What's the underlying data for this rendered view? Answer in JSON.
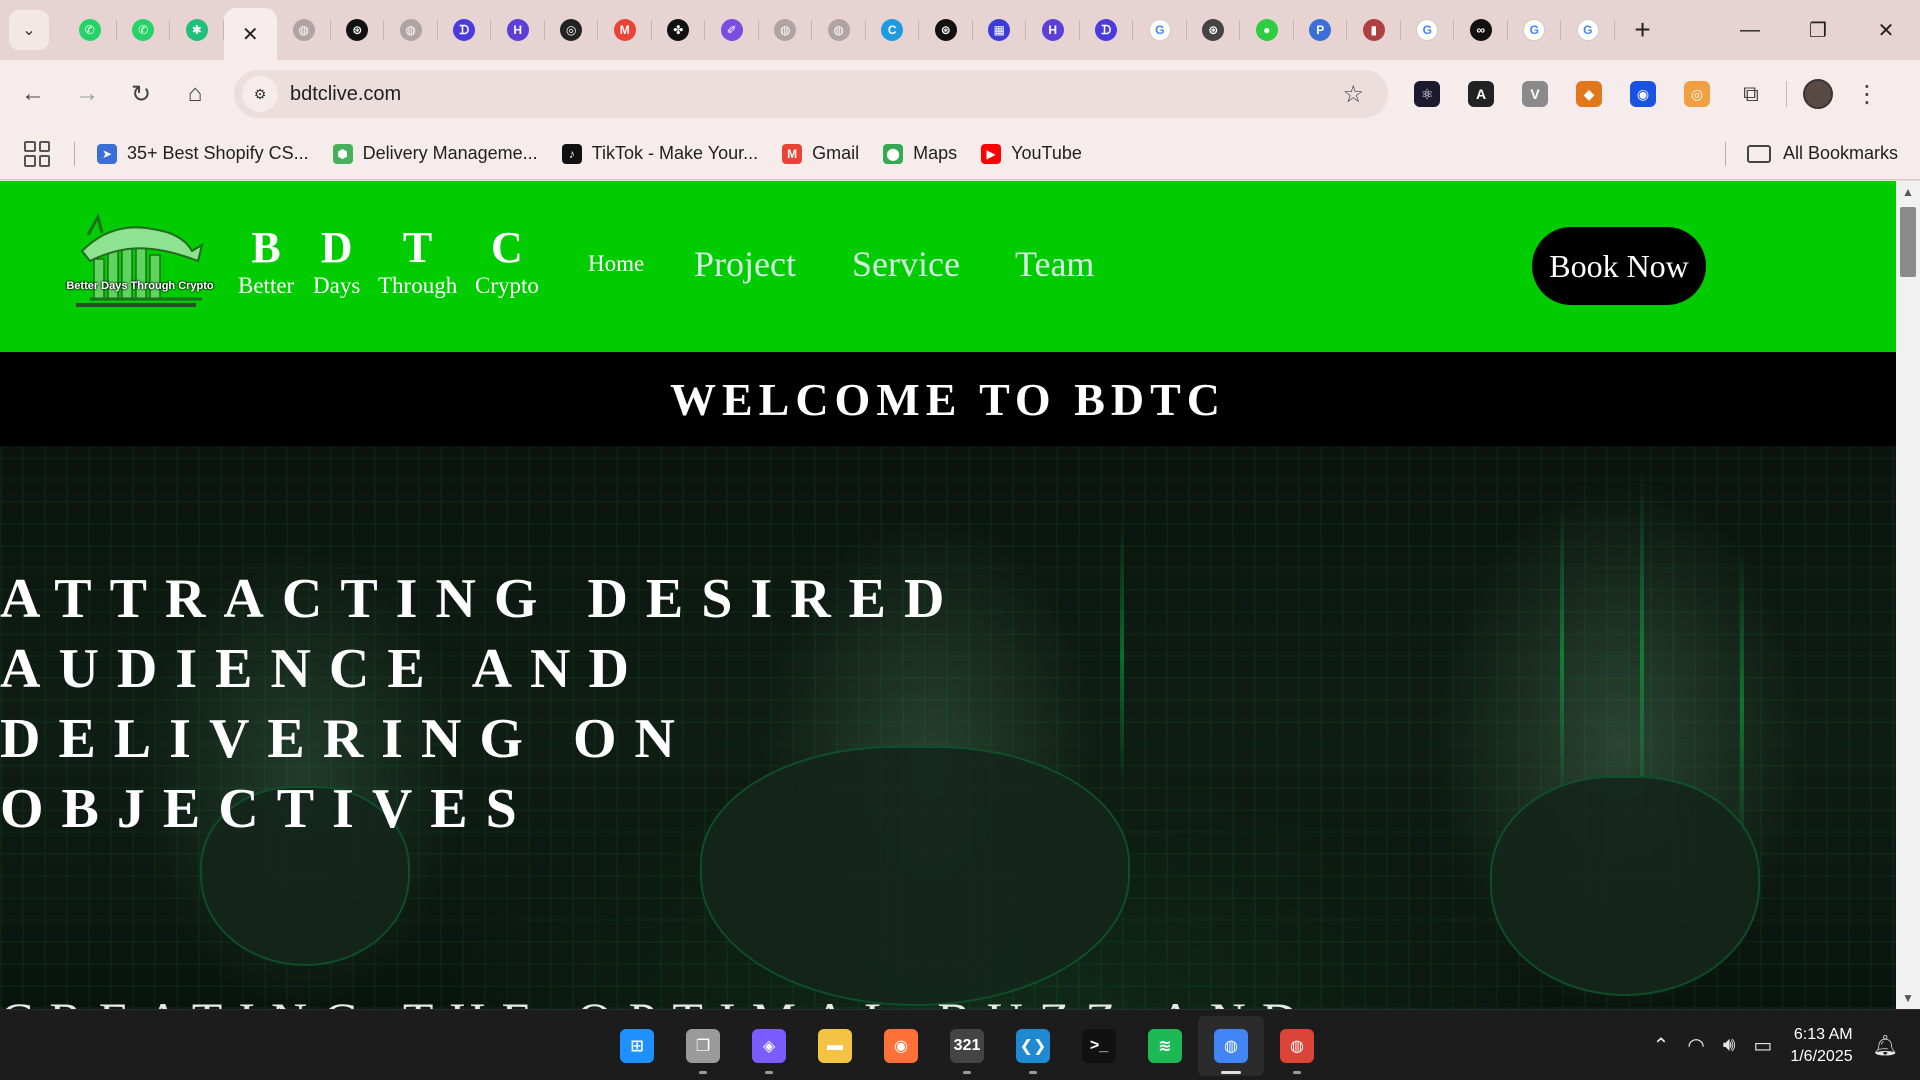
{
  "browser": {
    "tabs": [
      {
        "icon": "whatsapp-icon",
        "color": "#25d366",
        "glyph": "✆"
      },
      {
        "icon": "whatsapp-icon",
        "color": "#25d366",
        "glyph": "✆"
      },
      {
        "icon": "perplexity-icon",
        "color": "#21c07a",
        "glyph": "✱"
      },
      {
        "icon": "close-icon",
        "color": "#f7ecec",
        "glyph": "✕",
        "active": true
      },
      {
        "icon": "globe-icon",
        "color": "#b0a3a3",
        "glyph": "◍"
      },
      {
        "icon": "chatgpt-icon",
        "color": "#111111",
        "glyph": "⊛"
      },
      {
        "icon": "globe-icon",
        "color": "#b0a3a3",
        "glyph": "◍"
      },
      {
        "icon": "bolt-icon",
        "color": "#4a3ae0",
        "glyph": "ᗪ"
      },
      {
        "icon": "hashnode-icon",
        "color": "#5b3fd6",
        "glyph": "H"
      },
      {
        "icon": "github-icon",
        "color": "#222222",
        "glyph": "◎"
      },
      {
        "icon": "gmail-icon",
        "color": "#ea4335",
        "glyph": "M"
      },
      {
        "icon": "threads-icon",
        "color": "#111111",
        "glyph": "✤"
      },
      {
        "icon": "pen-icon",
        "color": "#7a4ce0",
        "glyph": "✐"
      },
      {
        "icon": "globe-icon",
        "color": "#b0a3a3",
        "glyph": "◍"
      },
      {
        "icon": "globe-icon",
        "color": "#b0a3a3",
        "glyph": "◍"
      },
      {
        "icon": "canva-icon",
        "color": "#1e9be0",
        "glyph": "C"
      },
      {
        "icon": "chatgpt-icon",
        "color": "#111111",
        "glyph": "⊛"
      },
      {
        "icon": "dashboard-icon",
        "color": "#3b3bd6",
        "glyph": "▦"
      },
      {
        "icon": "hashnode-icon",
        "color": "#5b3fd6",
        "glyph": "H"
      },
      {
        "icon": "bolt-icon",
        "color": "#4a3ae0",
        "glyph": "ᗪ"
      },
      {
        "icon": "google-icon",
        "color": "#ffffff",
        "glyph": "G"
      },
      {
        "icon": "chatgpt-icon",
        "color": "#444444",
        "glyph": "⊛"
      },
      {
        "icon": "green-dot-icon",
        "color": "#2ecc40",
        "glyph": "●"
      },
      {
        "icon": "pp-icon",
        "color": "#3b6fd6",
        "glyph": "P"
      },
      {
        "icon": "book-icon",
        "color": "#b04040",
        "glyph": "▮"
      },
      {
        "icon": "google-icon",
        "color": "#ffffff",
        "glyph": "G"
      },
      {
        "icon": "infinity-icon",
        "color": "#111111",
        "glyph": "∞"
      },
      {
        "icon": "google-icon",
        "color": "#ffffff",
        "glyph": "G"
      },
      {
        "icon": "google-icon",
        "color": "#ffffff",
        "glyph": "G"
      }
    ],
    "url": "bdtclive.com",
    "extensions": [
      {
        "name": "react-devtools-icon",
        "color": "#1b1b2f",
        "glyph": "⚛"
      },
      {
        "name": "angular-icon",
        "color": "#222222",
        "glyph": "A"
      },
      {
        "name": "vue-icon",
        "color": "#8a8a8a",
        "glyph": "V"
      },
      {
        "name": "metamask-icon",
        "color": "#e2761b",
        "glyph": "◆"
      },
      {
        "name": "blue-circle-icon",
        "color": "#1a53e0",
        "glyph": "◉"
      },
      {
        "name": "orange-extension-icon",
        "color": "#f0a040",
        "glyph": "◎"
      }
    ],
    "bookmarks": [
      {
        "label": "35+ Best Shopify CS...",
        "icon": "arrow-icon",
        "color": "#3b6fd6",
        "glyph": "➤"
      },
      {
        "label": "Delivery Manageme...",
        "icon": "shield-icon",
        "color": "#47b05a",
        "glyph": "⬢"
      },
      {
        "label": "TikTok - Make Your...",
        "icon": "tiktok-icon",
        "color": "#111111",
        "glyph": "♪"
      },
      {
        "label": "Gmail",
        "icon": "gmail-icon",
        "color": "#ea4335",
        "glyph": "M"
      },
      {
        "label": "Maps",
        "icon": "maps-icon",
        "color": "#34a853",
        "glyph": "⬤"
      },
      {
        "label": "YouTube",
        "icon": "youtube-icon",
        "color": "#ff0000",
        "glyph": "▶"
      }
    ],
    "all_bookmarks_label": "All Bookmarks"
  },
  "site": {
    "logo_text": "Better Days Through Crypto",
    "brand": [
      {
        "letter": "B",
        "word": "Better"
      },
      {
        "letter": "D",
        "word": "Days"
      },
      {
        "letter": "T",
        "word": "Through"
      },
      {
        "letter": "C",
        "word": "Crypto"
      }
    ],
    "nav": {
      "home": "Home",
      "project": "Project",
      "service": "Service",
      "team": "Team"
    },
    "book_now": "Book Now",
    "welcome": "WELCOME TO BDTC",
    "hero_title_lines": [
      "ATTRACTING DESIRED",
      "AUDIENCE AND",
      "DELIVERING ON",
      "OBJECTIVES"
    ],
    "hero_subtitle_partial": "CREATING THE OPTIMAL BUZZ AND",
    "colors": {
      "header_green": "#00cc00",
      "nav_link": "#d6efe4"
    }
  },
  "taskbar": {
    "apps": [
      {
        "name": "windows-start-icon",
        "color": "#1e90ff",
        "glyph": "⊞"
      },
      {
        "name": "task-view-icon",
        "color": "#9a9a9a",
        "glyph": "❐"
      },
      {
        "name": "copilot-icon",
        "color": "#7a5cff",
        "glyph": "◈"
      },
      {
        "name": "file-explorer-icon",
        "color": "#f5c343",
        "glyph": "▬"
      },
      {
        "name": "firefox-icon",
        "color": "#ff7139",
        "glyph": "◉"
      },
      {
        "name": "calendar-app-icon",
        "color": "#444444",
        "glyph": "321"
      },
      {
        "name": "vscode-icon",
        "color": "#1f8ad2",
        "glyph": "❮❯"
      },
      {
        "name": "terminal-icon",
        "color": "#111111",
        "glyph": ">_"
      },
      {
        "name": "spotify-icon",
        "color": "#1db954",
        "glyph": "≋"
      },
      {
        "name": "chrome-icon",
        "color": "#4285f4",
        "glyph": "◍",
        "active": true
      },
      {
        "name": "chrome-profile-icon",
        "color": "#db4437",
        "glyph": "◍"
      }
    ],
    "time": "6:13 AM",
    "date": "1/6/2025"
  }
}
